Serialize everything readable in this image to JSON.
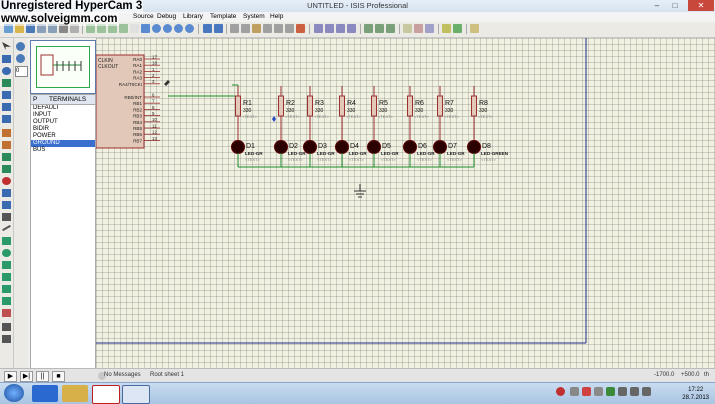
{
  "window": {
    "title": "UNTITLED - ISIS Professional"
  },
  "watermark": {
    "line1": "Unregistered HyperCam 3",
    "line2": "www.solveigmm.com"
  },
  "menu": [
    {
      "label": "Source"
    },
    {
      "label": "Debug"
    },
    {
      "label": "Library"
    },
    {
      "label": "Template"
    },
    {
      "label": "System"
    },
    {
      "label": "Help"
    }
  ],
  "panel": {
    "p_label": "P",
    "title": "TERMINALS",
    "items": [
      "DEFAULT",
      "INPUT",
      "OUTPUT",
      "BIDIR",
      "POWER",
      "GROUND",
      "BUS"
    ],
    "selected": "GROUND",
    "search_value": "0"
  },
  "schematic": {
    "mcu": {
      "pins_left": [
        "CLKIN",
        "CLKOUT"
      ],
      "pins_right": [
        "RA0",
        "RA1",
        "RA2",
        "RA3",
        "RA4/T0CKI",
        "RB0/INT",
        "RB1",
        "RB2",
        "RB3",
        "RB4",
        "RB5",
        "RB6",
        "RB7"
      ],
      "pin_numbers": [
        "17",
        "18",
        "1",
        "2",
        "3",
        "6",
        "7",
        "8",
        "9",
        "10",
        "11",
        "12",
        "13"
      ]
    },
    "resistors": [
      {
        "ref": "R1",
        "value": "330"
      },
      {
        "ref": "R2",
        "value": "330"
      },
      {
        "ref": "R3",
        "value": "330"
      },
      {
        "ref": "R4",
        "value": "330"
      },
      {
        "ref": "R5",
        "value": "330"
      },
      {
        "ref": "R6",
        "value": "330"
      },
      {
        "ref": "R7",
        "value": "330"
      },
      {
        "ref": "R8",
        "value": "330"
      }
    ],
    "text_placeholder": "<TEXT>",
    "leds": [
      {
        "ref": "D1",
        "part": "LED-GR"
      },
      {
        "ref": "D2",
        "part": "LED-GR"
      },
      {
        "ref": "D3",
        "part": "LED-GR"
      },
      {
        "ref": "D4",
        "part": "LED-GR"
      },
      {
        "ref": "D5",
        "part": "LED-GR"
      },
      {
        "ref": "D6",
        "part": "LED-GR"
      },
      {
        "ref": "D7",
        "part": "LED-GR"
      },
      {
        "ref": "D8",
        "part": "LED-GREEN"
      }
    ]
  },
  "status": {
    "messages": "No Messages",
    "sheet": "Root sheet 1",
    "coord_x": "-1700.0",
    "coord_y": "+500.0",
    "unit": "th"
  },
  "taskbar": {
    "time": "17:22",
    "date": "28.7.2013"
  }
}
